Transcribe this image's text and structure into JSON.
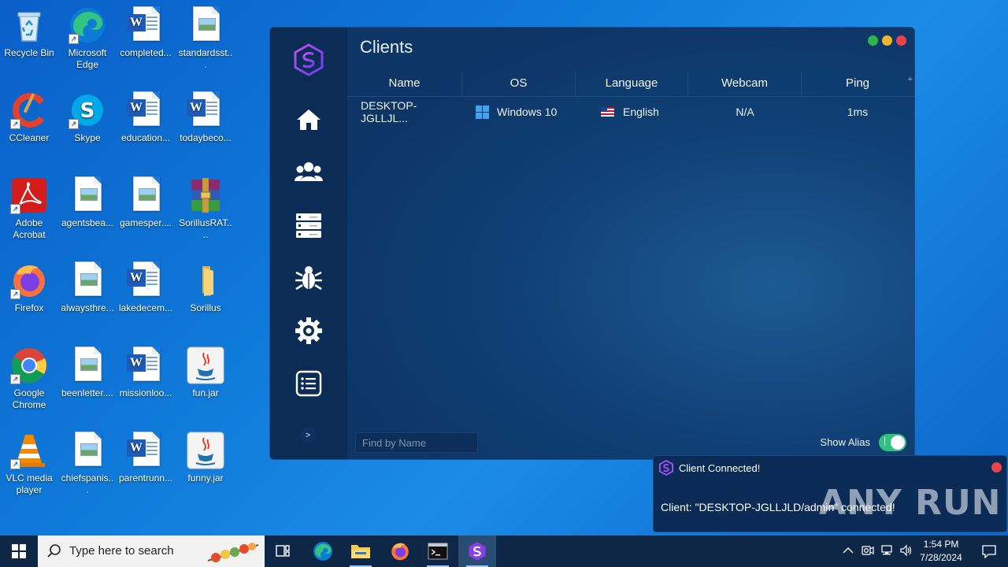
{
  "desktop": {
    "icons": [
      {
        "label": "Recycle Bin"
      },
      {
        "label": "Microsoft Edge"
      },
      {
        "label": "completed..."
      },
      {
        "label": "standardsst..."
      },
      {
        "label": "CCleaner"
      },
      {
        "label": "Skype"
      },
      {
        "label": "education..."
      },
      {
        "label": "todaybeco..."
      },
      {
        "label": "Adobe Acrobat"
      },
      {
        "label": "agentsbea..."
      },
      {
        "label": "gamesper...."
      },
      {
        "label": "SorillusRAT...."
      },
      {
        "label": "Firefox"
      },
      {
        "label": "alwaysthre..."
      },
      {
        "label": "lakedecem..."
      },
      {
        "label": "Sorillus"
      },
      {
        "label": "Google Chrome"
      },
      {
        "label": "beenletter...."
      },
      {
        "label": "missionloo..."
      },
      {
        "label": "fun.jar"
      },
      {
        "label": "VLC media player"
      },
      {
        "label": "chiefspanis..."
      },
      {
        "label": "parentrunn..."
      },
      {
        "label": "funny.jar"
      }
    ]
  },
  "app": {
    "title": "Clients",
    "columns": [
      "Name",
      "OS",
      "Language",
      "Webcam",
      "Ping"
    ],
    "add_column_symbol": "+",
    "rows": [
      {
        "name": "DESKTOP-JGLLJL...",
        "os": "Windows 10",
        "language": "English",
        "webcam": "N/A",
        "ping": "1ms"
      }
    ],
    "search_placeholder": "Find by Name",
    "show_alias_label": "Show Alias",
    "show_alias_on": true,
    "expand_symbol": ">",
    "colors": {
      "accent": "#2ec27e",
      "close": "#e8434a",
      "minimize": "#f5b52a",
      "maximize": "#2bb54a",
      "brand": "#8b5cf6"
    }
  },
  "notification": {
    "title": "Client Connected!",
    "body": "Client: \"DESKTOP-JGLLJLD/admin\" connected!",
    "watermark": "ANY RUN"
  },
  "taskbar": {
    "search_placeholder": "Type here to search",
    "time": "1:54 PM",
    "date": "7/28/2024"
  }
}
